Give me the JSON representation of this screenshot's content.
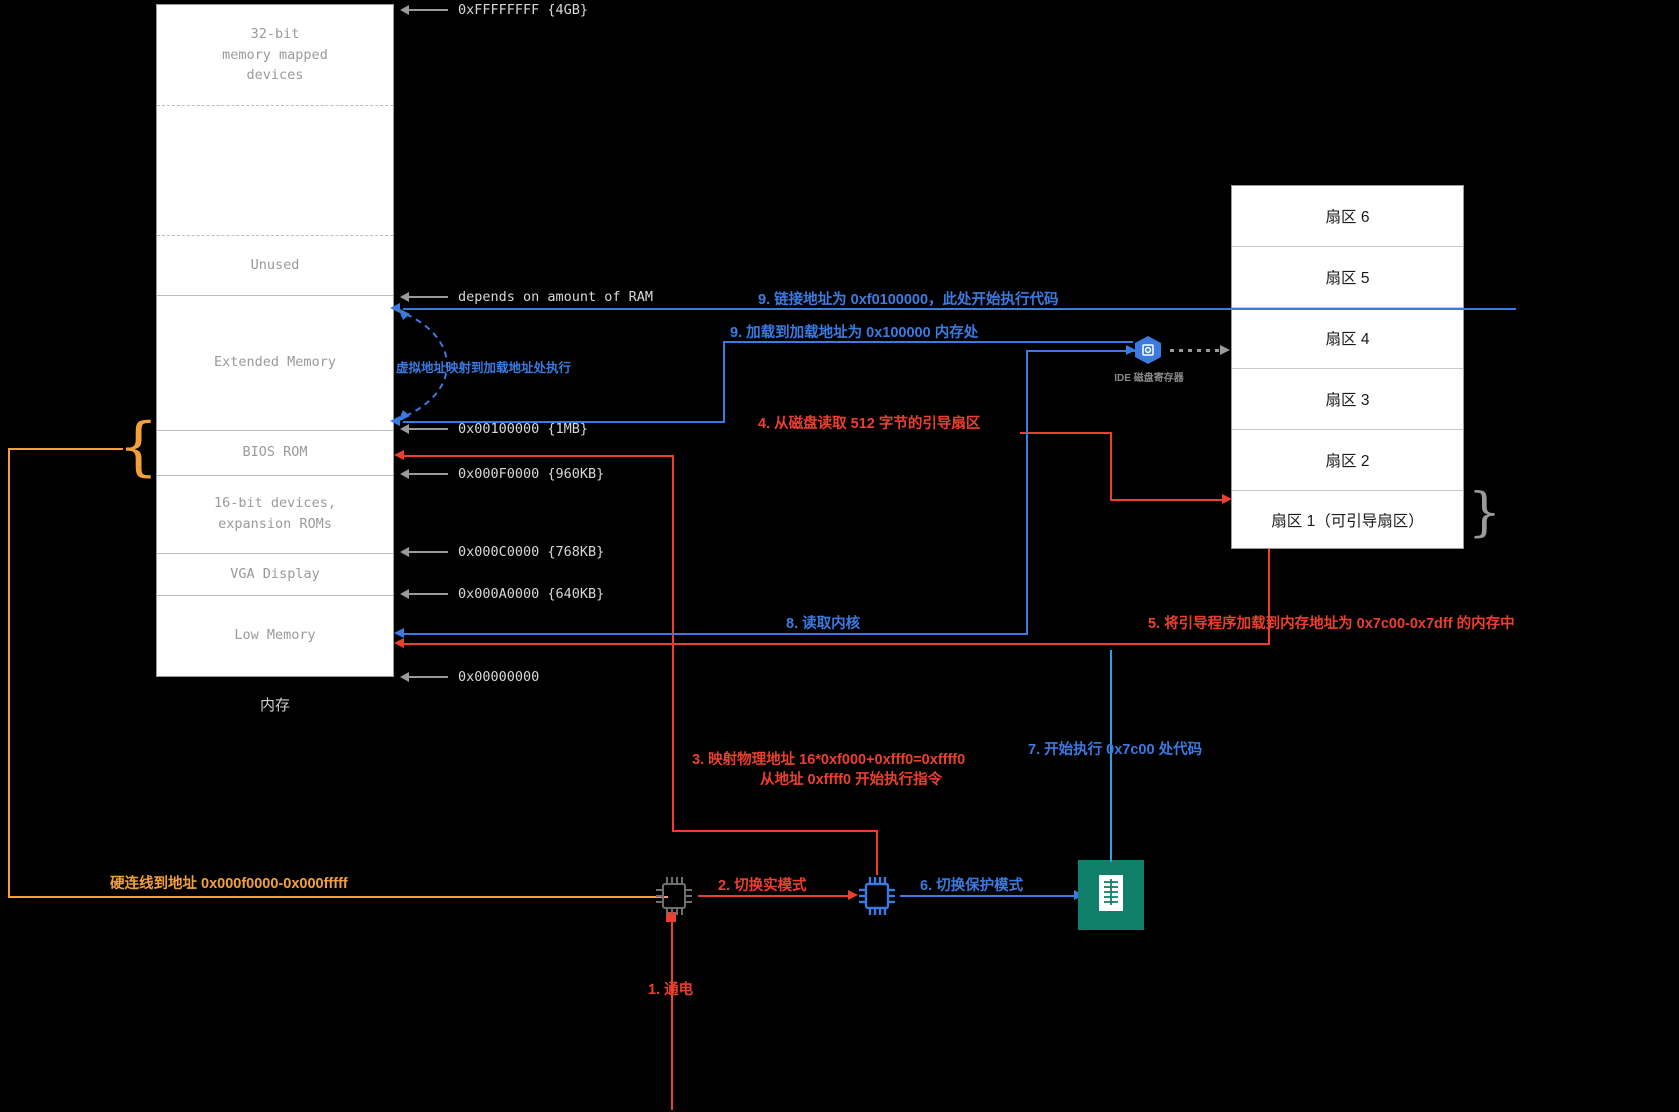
{
  "memory_map": {
    "caption": "内存",
    "segments": [
      {
        "label": "32-bit\nmemory mapped\ndevices"
      },
      {
        "label": "Unused"
      },
      {
        "label": "Extended Memory"
      },
      {
        "label": "BIOS ROM"
      },
      {
        "label": "16-bit devices,\nexpansion ROMs"
      },
      {
        "label": "VGA Display"
      },
      {
        "label": "Low Memory"
      }
    ],
    "address_marks": [
      {
        "text": "0xFFFFFFFF {4GB}"
      },
      {
        "text": "depends on amount of RAM"
      },
      {
        "text": "0x00100000 {1MB}"
      },
      {
        "text": "0x000F0000 {960KB}"
      },
      {
        "text": "0x000C0000 {768KB}"
      },
      {
        "text": "0x000A0000 {640KB}"
      },
      {
        "text": "0x00000000"
      }
    ]
  },
  "disk": {
    "sectors": [
      {
        "label": "扇区 6"
      },
      {
        "label": "扇区 5"
      },
      {
        "label": "扇区 4"
      },
      {
        "label": "扇区 3"
      },
      {
        "label": "扇区 2"
      },
      {
        "label": "扇区 1（可引导扇区）"
      }
    ],
    "ide_register_label": "IDE 磁盘寄存器"
  },
  "steps": {
    "power_on": "1. 通电",
    "switch_real_mode": "2. 切换实模式",
    "map_physical_line1": "3. 映射物理地址 16*0xf000+0xfff0=0xffff0",
    "map_physical_line2": "从地址 0xffff0 开始执行指令",
    "read_boot_sector": "4. 从磁盘读取 512 字节的引导扇区",
    "load_bootloader": "5. 将引导程序加载到内存地址为 0x7c00-0x7dff 的内存中",
    "switch_protected_mode": "6. 切换保护模式",
    "execute_7c00": "7. 开始执行 0x7c00 处代码",
    "read_kernel": "8. 读取内核",
    "load_address": "9. 加载到加载地址为 0x100000 内存处",
    "link_address": "9. 链接地址为 0xf0100000，此处开始执行代码"
  },
  "annotations": {
    "hardwired": "硬连线到地址 0x000f0000-0x000fffff",
    "virtual_map": "虚拟地址映射到加载地址处执行"
  },
  "colors": {
    "red": "#ed3f2e",
    "blue": "#3b7ae0",
    "orange": "#f3a03a",
    "cyan": "#2aa3dd",
    "green": "#10806a",
    "gray": "#9a9a9a"
  }
}
